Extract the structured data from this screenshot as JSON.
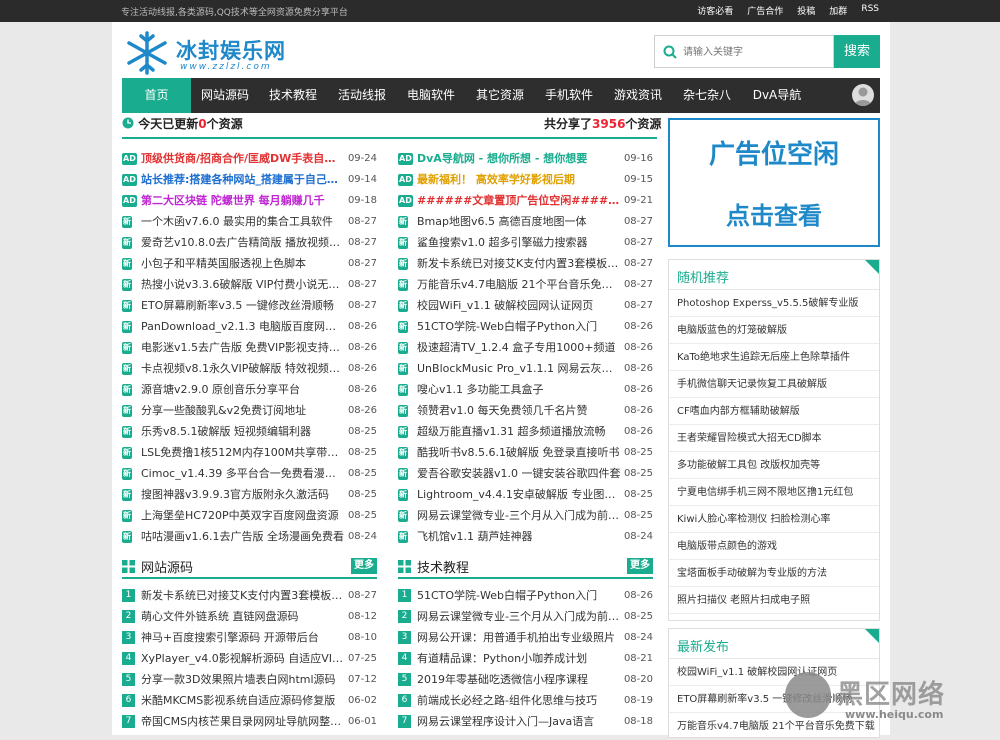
{
  "topbar": {
    "tagline": "专注活动线报,各类源码,QQ技术等全网资源免费分享平台",
    "links": [
      "访客必看",
      "广告合作",
      "投稿",
      "加群",
      "RSS"
    ]
  },
  "logo": {
    "title": "冰封娱乐网",
    "url": "www.zzlzl.com"
  },
  "search": {
    "placeholder": "请输入关键字",
    "button": "搜索"
  },
  "nav": [
    "首页",
    "网站源码",
    "技术教程",
    "活动线报",
    "电脑软件",
    "其它资源",
    "手机软件",
    "游戏资讯",
    "杂七杂八",
    "DvA导航"
  ],
  "summary": {
    "today_prefix": "今天已更新",
    "today_count": "0",
    "today_suffix": "个资源",
    "total_prefix": "共分享了",
    "total_count": "3956",
    "total_suffix": "个资源"
  },
  "colors": {
    "accent": "#1aac8f",
    "brand_blue": "#1e88c9",
    "dark": "#2e2e2e",
    "red": "#e23333",
    "purple": "#c026d3"
  },
  "left_list": [
    {
      "badge": "AD",
      "text": "顶级供货商/招商合作/匡威DW手表自有工厂",
      "date": "09-24",
      "color": "#e23333",
      "bold": true
    },
    {
      "badge": "AD",
      "text": "站长推荐:搭建各种网站_搭建属于自己的网站",
      "date": "09-14",
      "color": "#1e6fd0",
      "bold": true
    },
    {
      "badge": "AD",
      "text": "第二大区块链 陀螺世界 每月躺赚几千",
      "date": "09-18",
      "color": "#c026d3",
      "bold": true
    },
    {
      "badge": "新",
      "text": "一个木函v7.6.0 最实用的集合工具软件",
      "date": "08-27"
    },
    {
      "badge": "新",
      "text": "爱奇艺v10.8.0去广告精简版 播放视频零广告",
      "date": "08-27"
    },
    {
      "badge": "新",
      "text": "小包子和平精英国服透视上色脚本",
      "date": "08-27"
    },
    {
      "badge": "新",
      "text": "热搜小说v3.3.6破解版 VIP付费小说无广告阅读",
      "date": "08-27"
    },
    {
      "badge": "新",
      "text": "ETO屏幕刷新率v3.5 一键修改丝滑顺畅",
      "date": "08-27"
    },
    {
      "badge": "新",
      "text": "PanDownload_v2.1.3 电脑版百度网盘不限速",
      "date": "08-26"
    },
    {
      "badge": "新",
      "text": "电影迷v1.5去广告版 免费VIP影视支持投屏",
      "date": "08-26"
    },
    {
      "badge": "新",
      "text": "卡点视频v8.1永久VIP破解版 特效视频制作",
      "date": "08-26"
    },
    {
      "badge": "新",
      "text": "源音塘v2.9.0 原创音乐分享平台",
      "date": "08-26"
    },
    {
      "badge": "新",
      "text": "分享一些酸酸乳&v2免费订阅地址",
      "date": "08-26"
    },
    {
      "badge": "新",
      "text": "乐秀v8.5.1破解版 短视频编辑利器",
      "date": "08-25"
    },
    {
      "badge": "新",
      "text": "LSL免费撸1核512M内存100M共享带宽香港服务器",
      "date": "08-25"
    },
    {
      "badge": "新",
      "text": "Cimoc_v1.4.39 多平台合一免费看漫画app",
      "date": "08-25"
    },
    {
      "badge": "新",
      "text": "搜图神器v3.9.9.3官方版附永久激活码",
      "date": "08-25"
    },
    {
      "badge": "新",
      "text": "上海堡垒HC720P中英双字百度网盘资源",
      "date": "08-25"
    },
    {
      "badge": "新",
      "text": "咕咕漫画v1.6.1去广告版 全场漫画免费看",
      "date": "08-24"
    }
  ],
  "right_list": [
    {
      "badge": "AD",
      "text": "DvA导航网 - 想你所想 - 想你想要",
      "date": "09-16",
      "color": "#1aac8f",
      "bold": true
    },
    {
      "badge": "AD",
      "text": "最新福利！ 高效率学好影视后期",
      "date": "09-15",
      "color": "#e0a000",
      "bold": true
    },
    {
      "badge": "AD",
      "text": "######文章置顶广告位空闲######",
      "date": "09-21",
      "color": "#e23333",
      "bold": true
    },
    {
      "badge": "新",
      "text": "Bmap地图v6.5 高德百度地图一体",
      "date": "08-27"
    },
    {
      "badge": "新",
      "text": "鲨鱼搜索v1.0 超多引擎磁力搜索器",
      "date": "08-27"
    },
    {
      "badge": "新",
      "text": "新发卡系统已对接艾K支付内置3套模板可用",
      "date": "08-27"
    },
    {
      "badge": "新",
      "text": "万能音乐v4.7电脑版 21个平台音乐免费下载",
      "date": "08-27"
    },
    {
      "badge": "新",
      "text": "校园WiFi_v1.1 破解校园网认证网页",
      "date": "08-27"
    },
    {
      "badge": "新",
      "text": "51CTO学院-Web白帽子Python入门",
      "date": "08-26"
    },
    {
      "badge": "新",
      "text": "极速超清TV_1.2.4 盒子专用1000+频道",
      "date": "08-26"
    },
    {
      "badge": "新",
      "text": "UnBlockMusic Pro_v1.1.1 网易云灰色音乐解锁",
      "date": "08-26"
    },
    {
      "badge": "新",
      "text": "嗖心v1.1 多功能工具盒子",
      "date": "08-26"
    },
    {
      "badge": "新",
      "text": "领赞君v1.0 每天免费领几千名片赞",
      "date": "08-26"
    },
    {
      "badge": "新",
      "text": "超级万能直播v1.31 超多频道播放流畅",
      "date": "08-26"
    },
    {
      "badge": "新",
      "text": "酷我听书v8.5.6.1破解版 免登录直接听书",
      "date": "08-25"
    },
    {
      "badge": "新",
      "text": "爱吾谷歌安装器v1.0 一键安装谷歌四件套",
      "date": "08-25"
    },
    {
      "badge": "新",
      "text": "Lightroom_v4.4.1安卓破解版 专业图形后期处理",
      "date": "08-25"
    },
    {
      "badge": "新",
      "text": "网易云课堂微专业-三个月从入门成为前端工程师",
      "date": "08-25"
    },
    {
      "badge": "新",
      "text": "飞机馆v1.1 葫芦娃神器",
      "date": "08-24"
    }
  ],
  "sections": [
    {
      "title": "网站源码",
      "more": "更多",
      "items": [
        {
          "num": "1",
          "text": "新发卡系统已对接艾K支付内置3套模板可用",
          "date": "08-27"
        },
        {
          "num": "2",
          "text": "萌心文件外链系统 直链网盘源码",
          "date": "08-12"
        },
        {
          "num": "3",
          "text": "神马+百度搜索引擎源码 开源带后台",
          "date": "08-10"
        },
        {
          "num": "4",
          "text": "XyPlayer_v4.0影视解析源码 自适应VIP影视解析",
          "date": "07-25"
        },
        {
          "num": "5",
          "text": "分享一款3D效果照片墙表白网html源码",
          "date": "07-12"
        },
        {
          "num": "6",
          "text": "米酷MKCMS影视系统自适应源码修复版",
          "date": "06-02"
        },
        {
          "num": "7",
          "text": "帝国CMS内核芒果目录网网址导航网整站源码",
          "date": "06-01"
        }
      ]
    },
    {
      "title": "技术教程",
      "more": "更多",
      "items": [
        {
          "num": "1",
          "text": "51CTO学院-Web白帽子Python入门",
          "date": "08-26"
        },
        {
          "num": "2",
          "text": "网易云课堂微专业-三个月从入门成为前端工程师",
          "date": "08-25"
        },
        {
          "num": "3",
          "text": "网易公开课：用普通手机拍出专业级照片",
          "date": "08-24"
        },
        {
          "num": "4",
          "text": "有道精品课：Python小咖养成计划",
          "date": "08-21"
        },
        {
          "num": "5",
          "text": "2019年零基础吃透微信小程序课程",
          "date": "08-20"
        },
        {
          "num": "6",
          "text": "前端成长必经之路-组件化思维与技巧",
          "date": "08-19"
        },
        {
          "num": "7",
          "text": "网易云课堂程序设计入门—Java语言",
          "date": "08-18"
        }
      ]
    }
  ],
  "ad_box": {
    "line1": "广告位空闲",
    "line2": "点击查看"
  },
  "random": {
    "title": "随机推荐",
    "items": [
      "Photoshop Experss_v5.5.5破解专业版",
      "电脑版蓝色的灯笼破解版",
      "KaTo绝地求生追踪无后座上色除草插件",
      "手机微信聊天记录恢复工具破解版",
      "CF嗜血内部方框辅助破解版",
      "王者荣耀冒险模式大招无CD脚本",
      "多功能破解工具包 改版权加壳等",
      "宁夏电信绑手机三网不限地区撸1元红包",
      "Kiwi人脸心率检测仪 扫脸检测心率",
      "电脑版带点颜色的游戏",
      "宝塔面板手动破解为专业版的方法",
      "照片扫描仪 老照片扫成电子照"
    ]
  },
  "latest": {
    "title": "最新发布",
    "items": [
      "校园WiFi_v1.1 破解校园网认证网页",
      "ETO屏幕刷新率v3.5 一键修改丝滑顺畅",
      "万能音乐v4.7电脑版 21个平台音乐免费下载"
    ]
  },
  "watermark": {
    "text": "黑区网络",
    "url": "www.heiqu.com"
  }
}
